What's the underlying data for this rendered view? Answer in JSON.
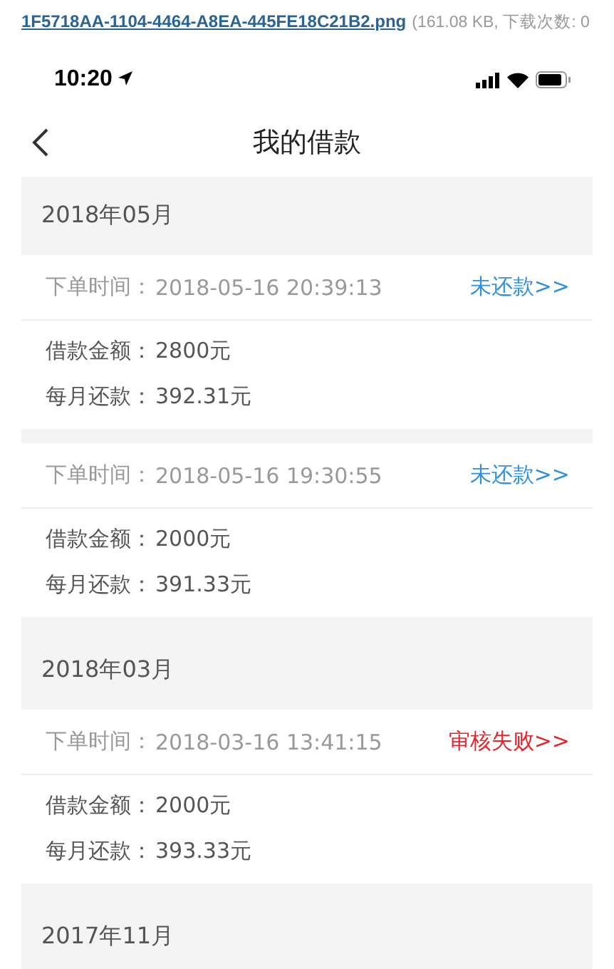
{
  "attachment": {
    "filename": "1F5718AA-1104-4464-A8EA-445FE18C21B2.png",
    "info": "(161.08 KB, 下载次数: 0"
  },
  "status_bar": {
    "time": "10:20"
  },
  "nav": {
    "title": "我的借款"
  },
  "groups": [
    {
      "month": "2018年05月",
      "orders": [
        {
          "time_label": "下单时间：",
          "time": "2018-05-16 20:39:13",
          "status": "未还款>>",
          "kind": "unpaid",
          "details": [
            {
              "label": "借款金额：",
              "value": "2800元"
            },
            {
              "label": "每月还款：",
              "value": "392.31元"
            }
          ]
        },
        {
          "time_label": "下单时间：",
          "time": "2018-05-16 19:30:55",
          "status": "未还款>>",
          "kind": "unpaid",
          "details": [
            {
              "label": "借款金额：",
              "value": "2000元"
            },
            {
              "label": "每月还款：",
              "value": "391.33元"
            }
          ]
        }
      ]
    },
    {
      "month": "2018年03月",
      "orders": [
        {
          "time_label": "下单时间：",
          "time": "2018-03-16 13:41:15",
          "status": "审核失败>>",
          "kind": "failed",
          "details": [
            {
              "label": "借款金额：",
              "value": "2000元"
            },
            {
              "label": "每月还款：",
              "value": "393.33元"
            }
          ]
        }
      ]
    },
    {
      "month": "2017年11月"
    }
  ]
}
